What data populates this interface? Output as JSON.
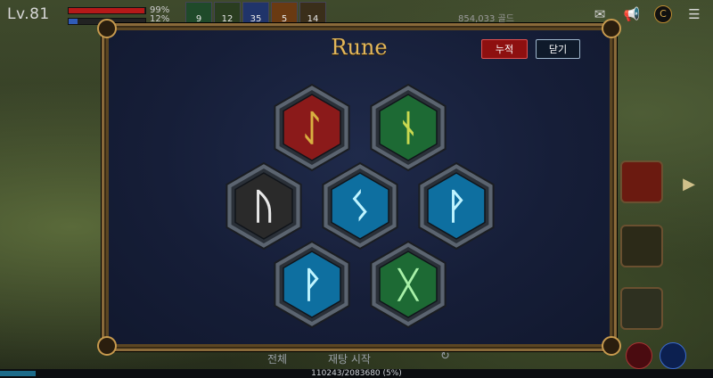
{
  "hud": {
    "level": "Lv.81",
    "hp_percent": "99%",
    "mp_percent": "12%",
    "hp_value": 0.99,
    "mp_value": 0.12,
    "slots": [
      "9",
      "12",
      "35",
      "5",
      "14"
    ],
    "gold": "854,033 골드",
    "exp_text": "110243/2083680 (5%)",
    "exp_value": 0.05
  },
  "panel": {
    "title": "Rune",
    "accumulate_button": "누적",
    "close_button": "닫기"
  },
  "runes": [
    {
      "name": "rune-red",
      "glyph": "ᛇ",
      "color": "#8b1a1a",
      "glyph_color": "#d8b040"
    },
    {
      "name": "rune-green-top",
      "glyph": "ᚾ",
      "color": "#1d6a34",
      "glyph_color": "#c8d850"
    },
    {
      "name": "rune-dark",
      "glyph": "ᚢ",
      "color": "#2a2a2a",
      "glyph_color": "#e8e8e8"
    },
    {
      "name": "rune-blue-center",
      "glyph": "ᛊ",
      "color": "#0e6fa0",
      "glyph_color": "#bff4ff"
    },
    {
      "name": "rune-blue-right",
      "glyph": "ᚹ",
      "color": "#0e6fa0",
      "glyph_color": "#bff4ff"
    },
    {
      "name": "rune-blue-bottom",
      "glyph": "ᚹ",
      "color": "#0e6fa0",
      "glyph_color": "#bff4ff"
    },
    {
      "name": "rune-green-bottom",
      "glyph": "ᚷ",
      "color": "#1d6a34",
      "glyph_color": "#a8f0a8"
    }
  ],
  "under_panel": {
    "all_label": "전체",
    "restart_label": "재탕 시작"
  }
}
